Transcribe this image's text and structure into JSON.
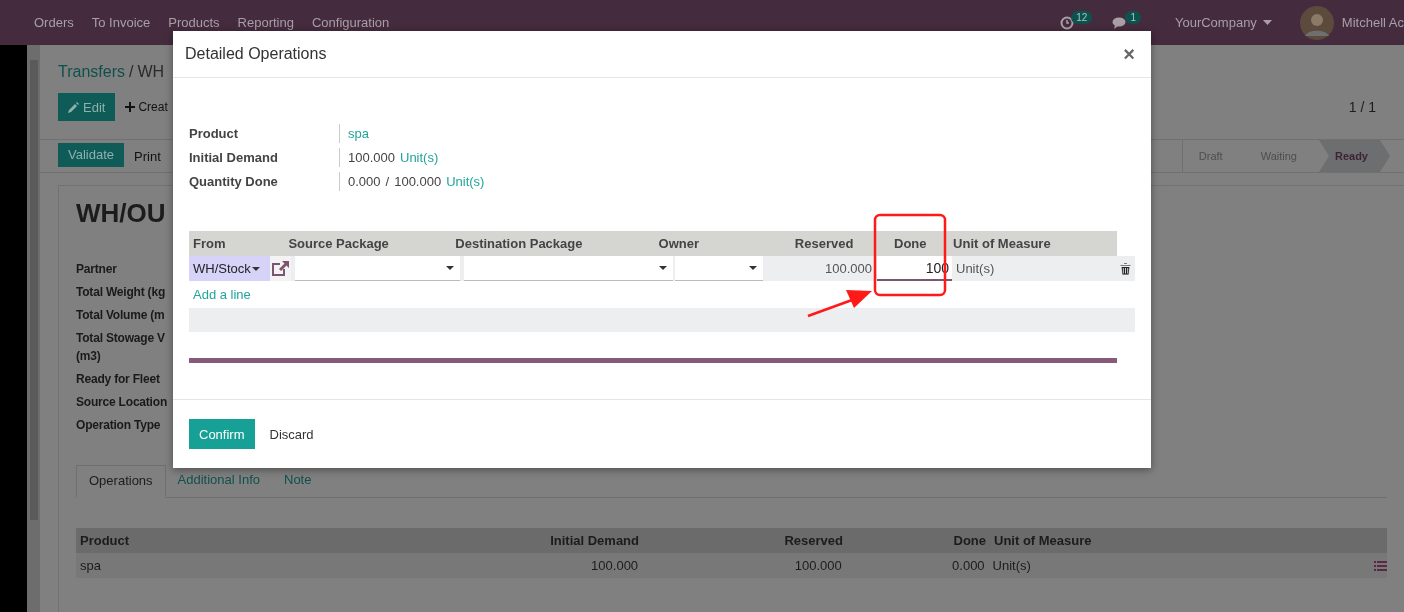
{
  "navbar": {
    "menu": [
      "Orders",
      "To Invoice",
      "Products",
      "Reporting",
      "Configuration"
    ],
    "activity_count": "12",
    "message_count": "1",
    "company": "YourCompany",
    "user": "Mitchell Ac"
  },
  "background": {
    "breadcrumb": [
      "Transfers",
      "WH"
    ],
    "breadcrumb_separator": "/",
    "edit_button": "Edit",
    "create_button": "Creat",
    "pager": "1 / 1",
    "actions": [
      "Validate",
      "Print"
    ],
    "statuses": [
      {
        "label": "Draft",
        "selected": false
      },
      {
        "label": "Waiting",
        "selected": false
      },
      {
        "label": "Ready",
        "selected": true
      }
    ],
    "record_title": "WH/OU",
    "field_labels": [
      "Partner",
      "Total Weight (kg",
      "Total Volume (m",
      "Total Stowage V\n(m3)",
      "Ready for Fleet",
      "Source Location",
      "Operation Type"
    ],
    "tabs": [
      {
        "label": "Operations",
        "selected": true
      },
      {
        "label": "Additional Info",
        "selected": false
      },
      {
        "label": "Note",
        "selected": false
      }
    ],
    "table": {
      "columns": [
        "Product",
        "Initial Demand",
        "Reserved",
        "Done",
        "Unit of Measure"
      ],
      "rows": [
        {
          "product": "spa",
          "initial_demand": "100.000",
          "reserved": "100.000",
          "done": "0.000",
          "uom": "Unit(s)"
        }
      ]
    }
  },
  "dialog": {
    "title": "Detailed Operations",
    "close": "×",
    "product": {
      "label": "Product",
      "value": "spa"
    },
    "initial_demand": {
      "label": "Initial Demand",
      "value": "100.000",
      "unit": "Unit(s)"
    },
    "quantity_done": {
      "label": "Quantity Done",
      "done": "0.000",
      "separator": "/",
      "total": "100.000",
      "unit": "Unit(s)"
    },
    "columns": [
      "From",
      "Source Package",
      "Destination Package",
      "Owner",
      "Reserved",
      "Done",
      "Unit of Measure"
    ],
    "rows": [
      {
        "from": "WH/Stock",
        "reserved": "100.000",
        "done": "100",
        "uom": "Unit(s)"
      }
    ],
    "add_line": "Add a line",
    "confirm": "Confirm",
    "discard": "Discard"
  }
}
